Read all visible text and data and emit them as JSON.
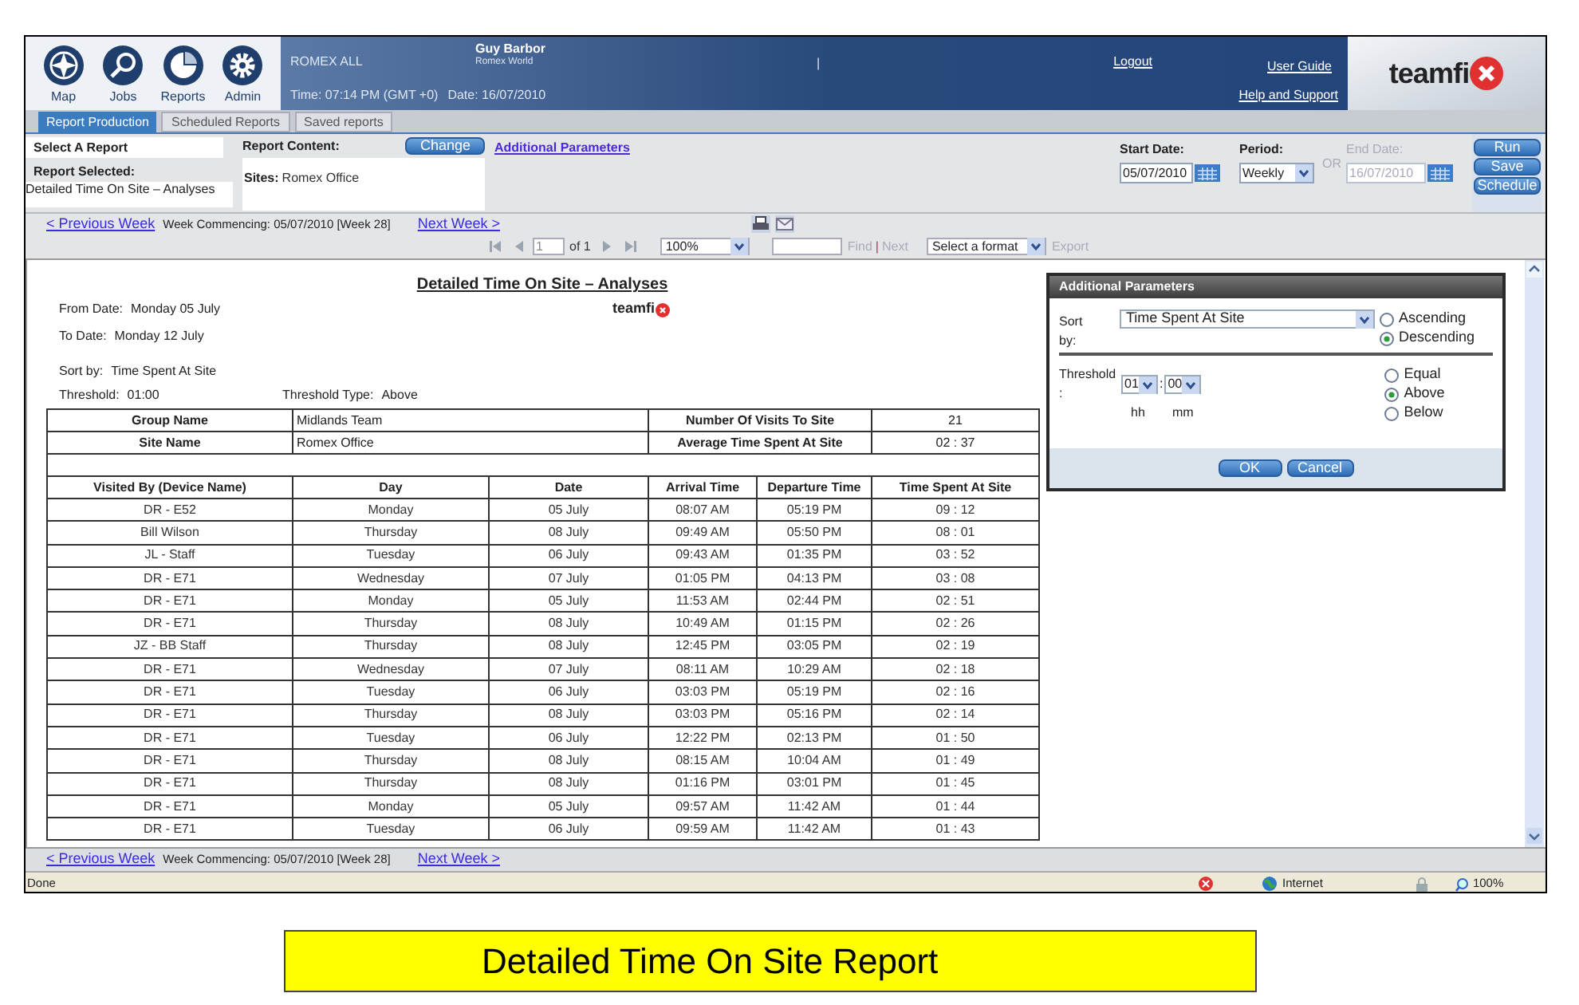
{
  "nav": [
    {
      "label": "Map"
    },
    {
      "label": "Jobs"
    },
    {
      "label": "Reports"
    },
    {
      "label": "Admin"
    }
  ],
  "header": {
    "account": "ROMEX ALL",
    "user": "Guy Barbor",
    "organisation": "Romex World",
    "time": "Time: 07:14 PM (GMT +0)",
    "date": "Date: 16/07/2010",
    "separator": "|",
    "logout": "Logout",
    "user_guide": "User Guide",
    "help": "Help and Support",
    "logo": "teamfi"
  },
  "tabs": [
    {
      "label": "Report Production",
      "selected": true
    },
    {
      "label": "Scheduled Reports",
      "selected": false
    },
    {
      "label": "Saved reports",
      "selected": false
    }
  ],
  "report_panel": {
    "select_report": "Select A Report",
    "report_selected_label": "Report Selected:",
    "report_selected": "Detailed Time On Site – Analyses",
    "content_label": "Report Content:",
    "change": "Change",
    "sites_label": "Sites:",
    "sites": "Romex Office",
    "additional_parameters": "Additional Parameters",
    "start_date_label": "Start Date:",
    "start_date": "05/07/2010",
    "period_label": "Period:",
    "period": "Weekly",
    "or": "OR",
    "end_date_label": "End Date:",
    "end_date": "16/07/2010",
    "end_date_disabled": true,
    "buttons": [
      "Run",
      "Save",
      "Schedule"
    ]
  },
  "week_nav_top": {
    "previous": "< Previous Week",
    "commencing": "Week Commencing: 05/07/2010 [Week 28]",
    "next": "Next Week >"
  },
  "toolbar": {
    "page": "1",
    "of": "of 1",
    "zoom": "100%",
    "find": "Find",
    "separator": "|",
    "next": "Next",
    "format": "Select a format",
    "export": "Export"
  },
  "report": {
    "title": "Detailed Time On Site – Analyses",
    "logo": "teamfi",
    "from_label": "From Date:",
    "from": "Monday 05 July",
    "to_label": "To Date:",
    "to": "Monday 12 July",
    "sort_label": "Sort by:",
    "sort": "Time Spent At Site",
    "threshold_label": "Threshold:",
    "threshold": "01:00",
    "threshold_type_label": "Threshold Type:",
    "threshold_type": "Above",
    "summary": [
      [
        "Group Name",
        "Midlands Team",
        "Number Of Visits To Site",
        "21"
      ],
      [
        "Site Name",
        "Romex Office",
        "Average Time Spent At Site",
        "02 : 37"
      ]
    ],
    "columns": [
      "Visited By (Device Name)",
      "Day",
      "Date",
      "Arrival Time",
      "Departure Time",
      "Time Spent At Site"
    ],
    "rows": [
      [
        "DR - E52",
        "Monday",
        "05 July",
        "08:07 AM",
        "05:19 PM",
        "09 : 12"
      ],
      [
        "Bill Wilson",
        "Thursday",
        "08 July",
        "09:49 AM",
        "05:50 PM",
        "08 : 01"
      ],
      [
        "JL - Staff",
        "Tuesday",
        "06 July",
        "09:43 AM",
        "01:35 PM",
        "03 : 52"
      ],
      [
        "DR - E71",
        "Wednesday",
        "07 July",
        "01:05 PM",
        "04:13 PM",
        "03 : 08"
      ],
      [
        "DR - E71",
        "Monday",
        "05 July",
        "11:53 AM",
        "02:44 PM",
        "02 : 51"
      ],
      [
        "DR - E71",
        "Thursday",
        "08 July",
        "10:49 AM",
        "01:15 PM",
        "02 : 26"
      ],
      [
        "JZ - BB Staff",
        "Thursday",
        "08 July",
        "12:45 PM",
        "03:05 PM",
        "02 : 19"
      ],
      [
        "DR - E71",
        "Wednesday",
        "07 July",
        "08:11 AM",
        "10:29 AM",
        "02 : 18"
      ],
      [
        "DR - E71",
        "Tuesday",
        "06 July",
        "03:03 PM",
        "05:19 PM",
        "02 : 16"
      ],
      [
        "DR - E71",
        "Thursday",
        "08 July",
        "03:03 PM",
        "05:16 PM",
        "02 : 14"
      ],
      [
        "DR - E71",
        "Tuesday",
        "06 July",
        "12:22 PM",
        "02:13 PM",
        "01 : 50"
      ],
      [
        "DR - E71",
        "Thursday",
        "08 July",
        "08:15 AM",
        "10:04 AM",
        "01 : 49"
      ],
      [
        "DR - E71",
        "Thursday",
        "08 July",
        "01:16 PM",
        "03:01 PM",
        "01 : 45"
      ],
      [
        "DR - E71",
        "Monday",
        "05 July",
        "09:57 AM",
        "11:42 AM",
        "01 : 44"
      ],
      [
        "DR - E71",
        "Tuesday",
        "06 July",
        "09:59 AM",
        "11:42 AM",
        "01 : 43"
      ]
    ]
  },
  "dialog": {
    "title": "Additional Parameters",
    "sort_label": "Sort by:",
    "sort": "Time Spent At Site",
    "order": [
      {
        "label": "Ascending",
        "selected": false
      },
      {
        "label": "Descending",
        "selected": true
      }
    ],
    "threshold_label": "Threshold :",
    "hours": "01",
    "colon": ":",
    "minutes": "00",
    "hours_unit": "hh",
    "minutes_unit": "mm",
    "threshold_type": [
      {
        "label": "Equal",
        "selected": false
      },
      {
        "label": "Above",
        "selected": true
      },
      {
        "label": "Below",
        "selected": false
      }
    ],
    "ok": "OK",
    "cancel": "Cancel"
  },
  "week_nav_bottom": {
    "previous": "< Previous Week",
    "commencing": "Week Commencing: 05/07/2010 [Week 28]",
    "next": "Next Week >"
  },
  "status_bar": {
    "status": "Done",
    "zone": "Internet",
    "zoom": "100%"
  },
  "caption": "Detailed Time On Site Report"
}
